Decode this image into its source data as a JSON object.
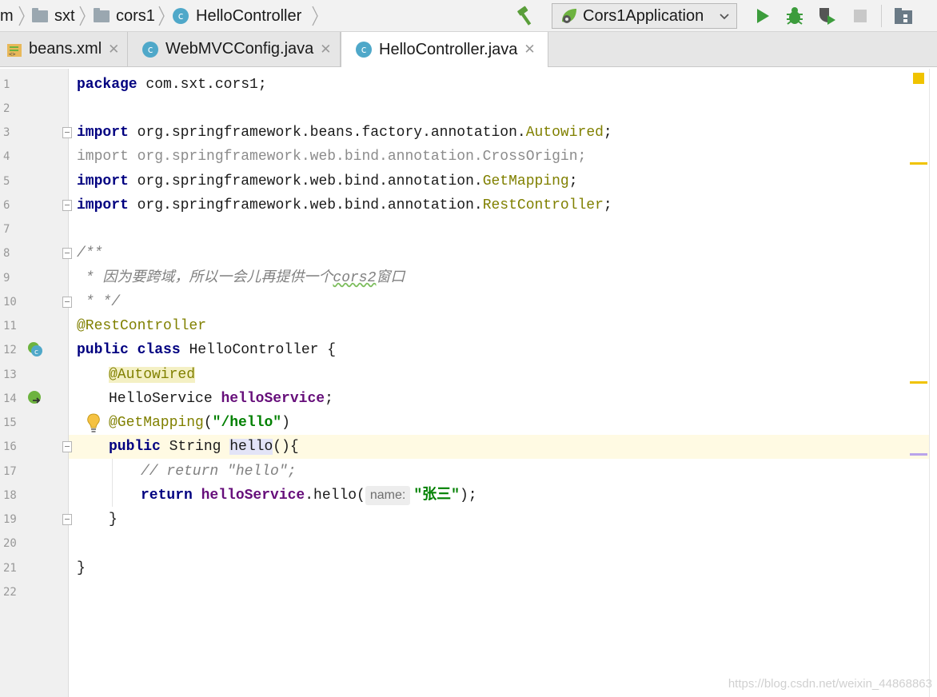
{
  "breadcrumbs": [
    "m",
    "sxt",
    "cors1",
    "HelloController"
  ],
  "run_config": {
    "label": "Cors1Application"
  },
  "tabs": [
    {
      "label": "beans.xml",
      "active": false
    },
    {
      "label": "WebMVCConfig.java",
      "active": false
    },
    {
      "label": "HelloController.java",
      "active": true
    }
  ],
  "icons": {
    "build": "hammer-icon",
    "run": "run-icon",
    "debug": "debug-icon",
    "coverage": "coverage-icon",
    "stop": "stop-icon",
    "structure": "project-structure-icon"
  },
  "line_numbers": [
    "1",
    "2",
    "3",
    "4",
    "5",
    "6",
    "7",
    "8",
    "9",
    "10",
    "11",
    "12",
    "13",
    "14",
    "15",
    "16",
    "17",
    "18",
    "19",
    "20",
    "21",
    "22"
  ],
  "code": {
    "l1": {
      "kw": "package",
      "rest": " com.sxt.cors1;"
    },
    "l3": {
      "kw": "import",
      "pkg": " org.springframework.beans.factory.annotation.",
      "cls": "Autowired",
      "end": ";"
    },
    "l4": {
      "text": "import org.springframework.web.bind.annotation.CrossOrigin;"
    },
    "l5": {
      "kw": "import",
      "pkg": " org.springframework.web.bind.annotation.",
      "cls": "GetMapping",
      "end": ";"
    },
    "l6": {
      "kw": "import",
      "pkg": " org.springframework.web.bind.annotation.",
      "cls": "RestController",
      "end": ";"
    },
    "l8": {
      "text": "/**"
    },
    "l9": {
      "pre": " * 因为要跨域，所以一会儿再提供一个",
      "squiggle": "cors2",
      "post": "窗口"
    },
    "l10": {
      "text": " * */"
    },
    "l11": {
      "text": "@RestController"
    },
    "l12": {
      "kw1": "public",
      "kw2": "class",
      "rest": " HelloController {"
    },
    "l13": {
      "text": "@Autowired"
    },
    "l14": {
      "type": "HelloService ",
      "field": "helloService",
      "end": ";"
    },
    "l15": {
      "ann": "@GetMapping",
      "open": "(",
      "str": "\"/hello\"",
      "close": ")"
    },
    "l16": {
      "kw": "public",
      "type": " String ",
      "method": "hello",
      "end": "(){"
    },
    "l17": {
      "text": "// return \"hello\";"
    },
    "l18": {
      "kw": "return",
      "field": " helloService",
      "call": ".hello(",
      "hint": "name:",
      "str": "\"张三\"",
      "end": ");"
    },
    "l19": {
      "text": "}"
    },
    "l21": {
      "text": "}"
    }
  },
  "watermark": "https://blog.csdn.net/weixin_44868863",
  "colors": {
    "current_line": "#fffae3",
    "keyword": "#000080",
    "annotation": "#808000",
    "string": "#008000",
    "field": "#660e7a"
  }
}
